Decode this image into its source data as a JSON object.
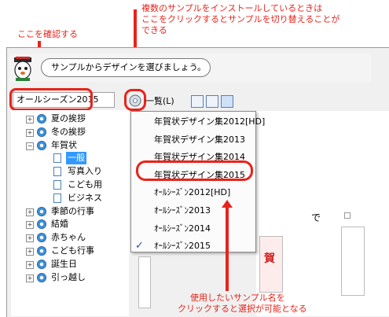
{
  "annotations": {
    "check_here": "ここを確認する",
    "switch_samples": [
      "複数のサンプルをインストールしているときは",
      "ここをクリックするとサンプルを切り替えることが",
      "できる"
    ],
    "click_to_select": [
      "使用したいサンプル名を",
      "クリックすると選択が可能となる"
    ]
  },
  "banner": {
    "message": "サンプルからデザインを選びましょう。"
  },
  "toolbar": {
    "combo_value": "オールシーズン2015",
    "list_label": "一覧(L)"
  },
  "tree": {
    "items": [
      {
        "label": "夏の挨拶",
        "kind": "folder"
      },
      {
        "label": "冬の挨拶",
        "kind": "folder"
      },
      {
        "label": "年賀状",
        "kind": "folder-open"
      },
      {
        "label": "一般",
        "kind": "leaf",
        "selected": true
      },
      {
        "label": "写真入り",
        "kind": "leaf"
      },
      {
        "label": "こども用",
        "kind": "leaf"
      },
      {
        "label": "ビジネス",
        "kind": "leaf"
      },
      {
        "label": "季節の行事",
        "kind": "folder"
      },
      {
        "label": "結婚",
        "kind": "folder"
      },
      {
        "label": "赤ちゃん",
        "kind": "folder"
      },
      {
        "label": "こども行事",
        "kind": "folder"
      },
      {
        "label": "誕生日",
        "kind": "folder"
      },
      {
        "label": "引っ越し",
        "kind": "folder"
      }
    ]
  },
  "menu": {
    "items": [
      {
        "label": "年賀状デザイン集2012[HD]",
        "checked": false,
        "highlighted": false
      },
      {
        "label": "年賀状デザイン集2013",
        "checked": false,
        "highlighted": false
      },
      {
        "label": "年賀状デザイン集2014",
        "checked": false,
        "highlighted": false
      },
      {
        "label": "年賀状デザイン集2015",
        "checked": false,
        "highlighted": true
      },
      {
        "label": "ｵｰﾙｼｰｽﾞﾝ2012[HD]",
        "checked": false,
        "highlighted": false
      },
      {
        "label": "ｵｰﾙｼｰｽﾞﾝ2013",
        "checked": false,
        "highlighted": false
      },
      {
        "label": "ｵｰﾙｼｰｽﾞﾝ2014",
        "checked": false,
        "highlighted": false
      },
      {
        "label": "ｵｰﾙｼｰｽﾞﾝ2015",
        "checked": true,
        "highlighted": false
      }
    ],
    "check_mark": "✓"
  },
  "preview": {
    "side_char": "で",
    "side_char2": "賀"
  },
  "colors": {
    "annotation_red": "#e8231b",
    "selection_blue": "#3399ff"
  }
}
